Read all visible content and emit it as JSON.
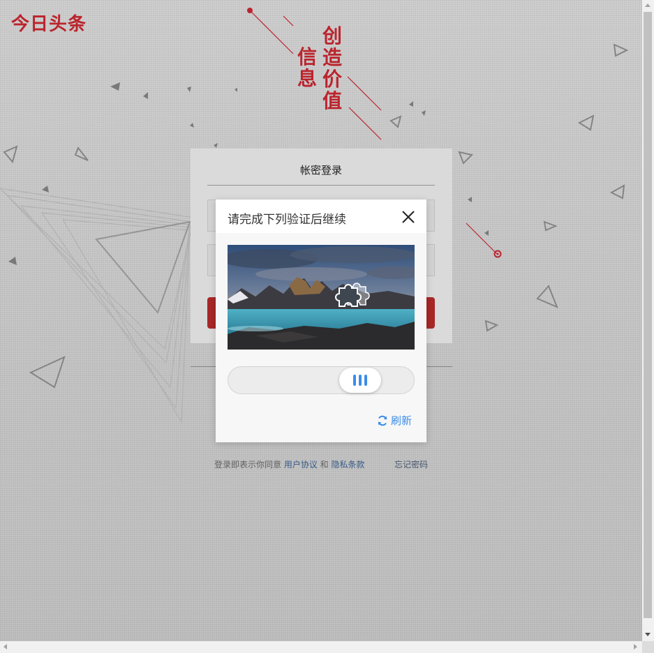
{
  "brand": {
    "logo": "今日头条",
    "accent_color": "#c3262f"
  },
  "slogan": {
    "left_column": "信息",
    "right_column": "创造价值"
  },
  "login": {
    "tab_label": "帐密登录",
    "agree_prefix": "登录即表示你同意 ",
    "user_agreement": "用户协议",
    "and": " 和 ",
    "privacy_terms": "隐私条款",
    "forgot_password": "忘记密码"
  },
  "captcha": {
    "title": "请完成下列验证后继续",
    "close_icon": "close-icon",
    "slider_progress": 0.62,
    "refresh_label": "刷新",
    "refresh_icon": "refresh-icon",
    "accent_color": "#3c8ce8"
  }
}
